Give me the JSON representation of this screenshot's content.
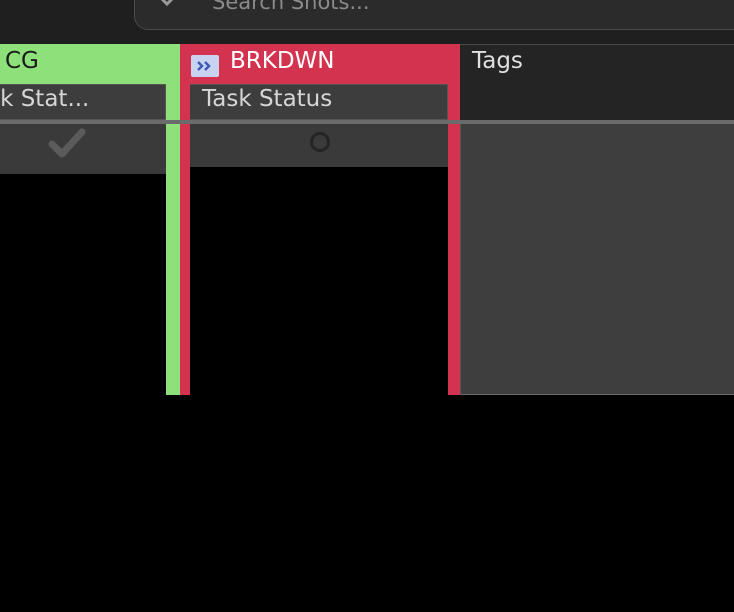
{
  "search": {
    "placeholder": "Search Shots..."
  },
  "columns": [
    {
      "title": "CG",
      "subheader": "ask Stat...",
      "color": "#8ee07a",
      "cell_icon": "checkmark-icon"
    },
    {
      "title": "BRKDWN",
      "subheader": "Task Status",
      "color": "#d3334f",
      "title_icon": "double-chevron-right-icon",
      "cell_icon": "status-circle-icon"
    },
    {
      "title": "Tags"
    }
  ],
  "colors": {
    "background": "#000000",
    "cell": "#3a3a3a",
    "cg_accent": "#8ee07a",
    "brkdwn_accent": "#d3334f",
    "tags_header": "#242424"
  }
}
